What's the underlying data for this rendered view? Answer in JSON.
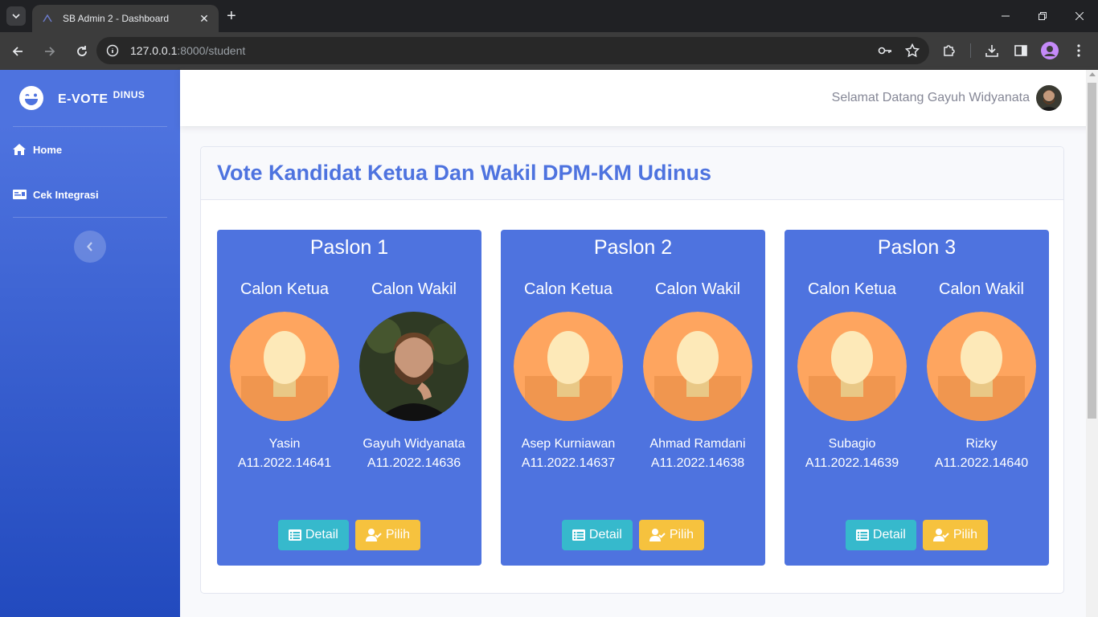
{
  "browser": {
    "tab_title": "SB Admin 2 - Dashboard",
    "url_host": "127.0.0.1",
    "url_path": ":8000/student"
  },
  "sidebar": {
    "brand": "E-VOTE",
    "brand_sup": "DINUS",
    "items": [
      {
        "label": "Home",
        "icon": "home-icon"
      },
      {
        "label": "Cek Integrasi",
        "icon": "id-card-icon"
      }
    ]
  },
  "topbar": {
    "welcome": "Selamat Datang Gayuh Widyanata"
  },
  "card": {
    "title": "Vote Kandidat Ketua Dan Wakil DPM-KM Udinus"
  },
  "labels": {
    "ketua": "Calon Ketua",
    "wakil": "Calon Wakil",
    "detail": "Detail",
    "pilih": "Pilih"
  },
  "paslon": [
    {
      "title": "Paslon 1",
      "ketua": {
        "name": "Yasin",
        "nim": "A11.2022.14641"
      },
      "wakil": {
        "name": "Gayuh Widyanata",
        "nim": "A11.2022.14636"
      }
    },
    {
      "title": "Paslon 2",
      "ketua": {
        "name": "Asep Kurniawan",
        "nim": "A11.2022.14637"
      },
      "wakil": {
        "name": "Ahmad Ramdani",
        "nim": "A11.2022.14638"
      }
    },
    {
      "title": "Paslon 3",
      "ketua": {
        "name": "Subagio",
        "nim": "A11.2022.14639"
      },
      "wakil": {
        "name": "Rizky",
        "nim": "A11.2022.14640"
      }
    }
  ],
  "colors": {
    "primary": "#4e73df",
    "info": "#36b9cc",
    "warning": "#f6c23e"
  }
}
